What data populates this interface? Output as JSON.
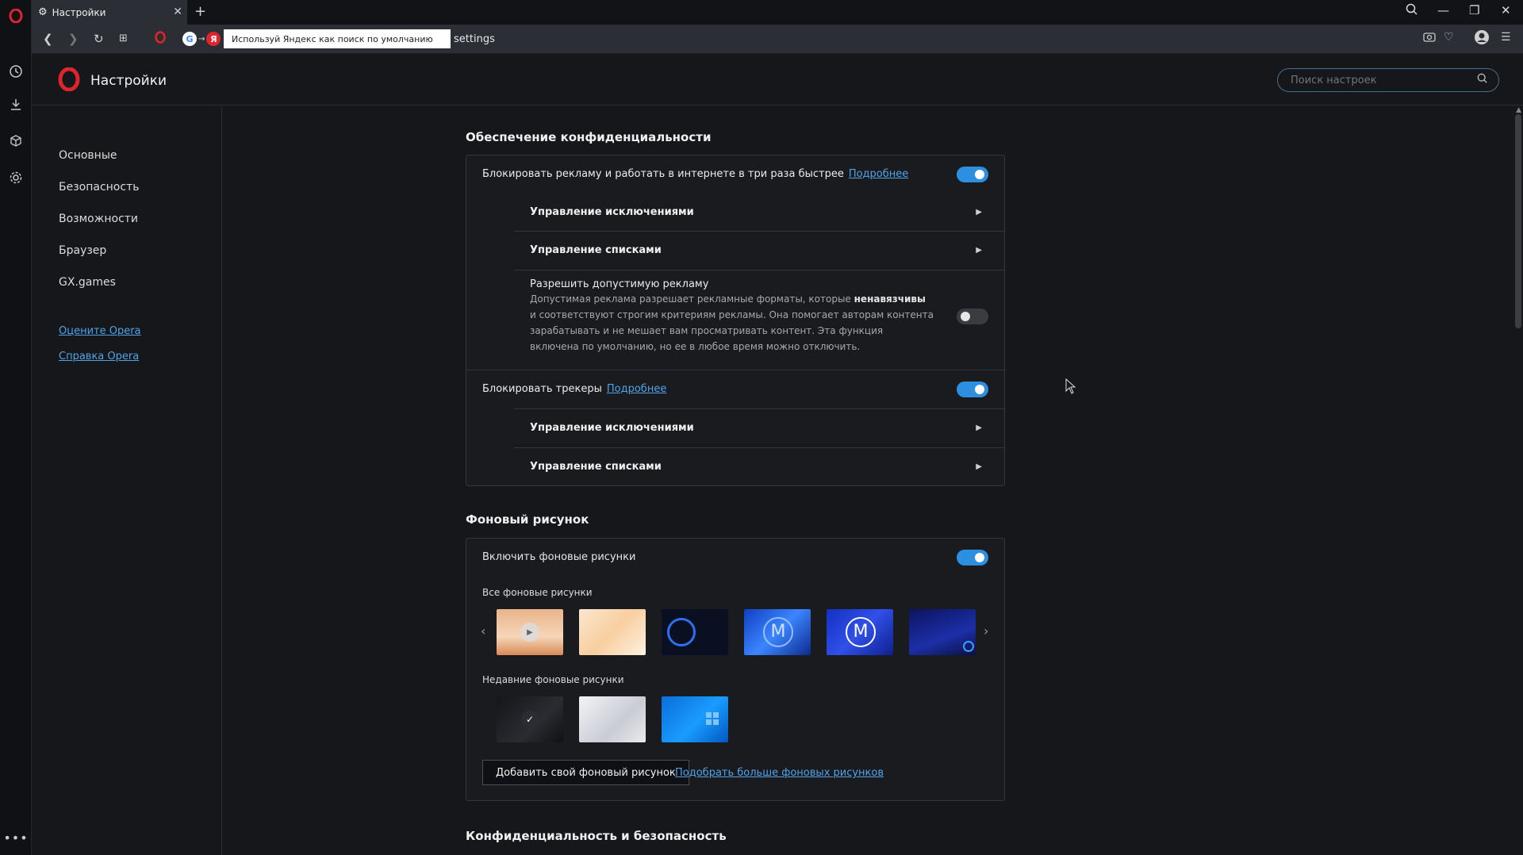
{
  "browser": {
    "tab_title": "Настройки",
    "search_hint": "Используй Яндекс как поиск по умолчанию",
    "url": "settings"
  },
  "header": {
    "title": "Настройки",
    "search_placeholder": "Поиск настроек"
  },
  "sidebar": {
    "items": [
      "Основные",
      "Безопасность",
      "Возможности",
      "Браузер",
      "GX.games"
    ],
    "links": [
      "Оцените Opera",
      "Справка Opera"
    ]
  },
  "privacy": {
    "title": "Обеспечение конфиденциальности",
    "adblock_label": "Блокировать рекламу и работать в интернете в три раза быстрее",
    "adblock_link": "Подробнее",
    "adblock_on": true,
    "manage_exceptions": "Управление исключениями",
    "manage_lists": "Управление списками",
    "acceptable_ads_title": "Разрешить допустимую рекламу",
    "acceptable_ads_desc_1": "Допустимая реклама разрешает рекламные форматы, которые ",
    "acceptable_ads_desc_bold": "ненавязчивы",
    "acceptable_ads_desc_2": " и соответствуют строгим критериям рекламы. Она помогает авторам контента зарабатывать и не мешает вам просматривать контент. Эта функция включена по умолчанию, но ее в любое время можно отключить.",
    "acceptable_ads_on": false,
    "trackers_label": "Блокировать трекеры",
    "trackers_link": "Подробнее",
    "trackers_on": true,
    "manage_exceptions_2": "Управление исключениями",
    "manage_lists_2": "Управление списками"
  },
  "wallpaper": {
    "title": "Фоновый рисунок",
    "enable_label": "Включить фоновые рисунки",
    "enable_on": true,
    "all_label": "Все фоновые рисунки",
    "recent_label": "Недавние фоновые рисунки",
    "add_button": "Добавить свой фоновый рисунок",
    "more_link": "Подобрать больше фоновых рисунков"
  },
  "next_section": {
    "title": "Конфиденциальность и безопасность"
  },
  "colors": {
    "accent": "#2d8fe0",
    "link": "#4fa3e8",
    "opera_red": "#e0242b"
  }
}
